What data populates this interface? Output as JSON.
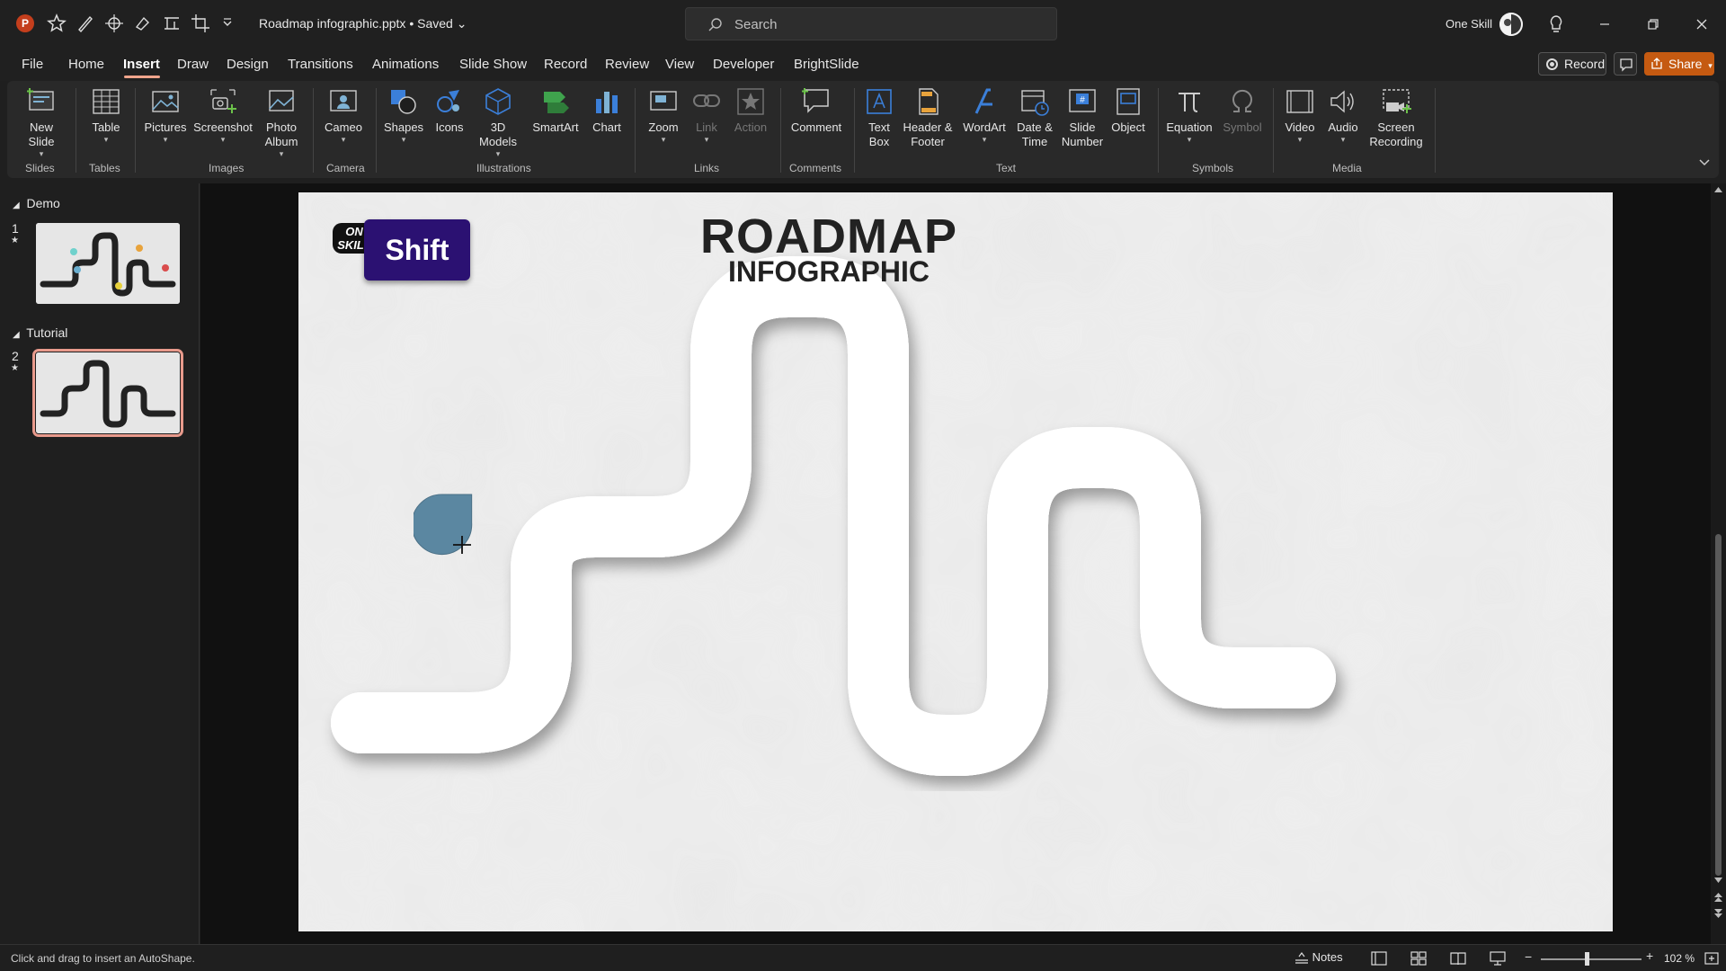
{
  "titlebar": {
    "document_title": "Roadmap infographic.pptx • Saved",
    "search_placeholder": "Search",
    "user_name": "One Skill"
  },
  "menu": {
    "items": [
      "File",
      "Home",
      "Insert",
      "Draw",
      "Design",
      "Transitions",
      "Animations",
      "Slide Show",
      "Record",
      "Review",
      "View",
      "Developer",
      "BrightSlide"
    ],
    "active": "Insert",
    "record_label": "Record",
    "share_label": "Share"
  },
  "ribbon": {
    "buttons": {
      "new_slide": "New Slide",
      "table": "Table",
      "pictures": "Pictures",
      "screenshot": "Screenshot",
      "photo_album": "Photo Album",
      "cameo": "Cameo",
      "shapes": "Shapes",
      "icons": "Icons",
      "models_3d": "3D Models",
      "smartart": "SmartArt",
      "chart": "Chart",
      "zoom": "Zoom",
      "link": "Link",
      "action": "Action",
      "comment": "Comment",
      "text_box": "Text Box",
      "header_footer": "Header & Footer",
      "wordart": "WordArt",
      "date_time": "Date & Time",
      "slide_number": "Slide Number",
      "object": "Object",
      "equation": "Equation",
      "symbol": "Symbol",
      "video": "Video",
      "audio": "Audio",
      "screen_recording": "Screen Recording"
    },
    "groups": {
      "slides": "Slides",
      "tables": "Tables",
      "images": "Images",
      "camera": "Camera",
      "illustrations": "Illustrations",
      "links": "Links",
      "comments": "Comments",
      "text": "Text",
      "symbols": "Symbols",
      "media": "Media"
    }
  },
  "slides_panel": {
    "sections": [
      {
        "name": "Demo",
        "slide_number": "1"
      },
      {
        "name": "Tutorial",
        "slide_number": "2"
      }
    ],
    "selected_slide": 2
  },
  "slide": {
    "title_line1": "ROADMAP",
    "title_line2": "INFOGRAPHIC",
    "logo_text": "ON SKILL",
    "key_badge": "Shift",
    "road_color": "#222831",
    "shape_color": "#5b87a1"
  },
  "statusbar": {
    "message": "Click and drag to insert an AutoShape.",
    "notes_label": "Notes",
    "zoom": "102 %"
  },
  "colors": {
    "accent": "#c55a11",
    "tab_underline": "#f0a58c",
    "badge_bg": "#2b1172"
  }
}
